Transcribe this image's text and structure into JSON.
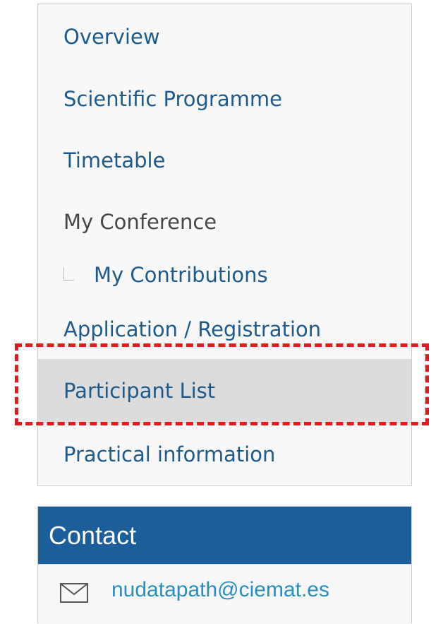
{
  "menu": {
    "items": [
      {
        "label": "Overview",
        "type": "link"
      },
      {
        "label": "Scientific Programme",
        "type": "link"
      },
      {
        "label": "Timetable",
        "type": "link"
      },
      {
        "label": "My Conference",
        "type": "section"
      },
      {
        "label": "My Contributions",
        "type": "sub-link"
      },
      {
        "label": "Application / Registration",
        "type": "link"
      },
      {
        "label": "Participant List",
        "type": "link",
        "selected": true
      },
      {
        "label": "Practical information",
        "type": "link"
      }
    ]
  },
  "contact": {
    "title": "Contact",
    "email": "nudatapath@ciemat.es",
    "icon": "mail-icon"
  },
  "colors": {
    "link": "#1f5a8c",
    "header": "#1b5e99",
    "highlight": "#e8191c",
    "selected_bg": "#dcdcdc"
  }
}
